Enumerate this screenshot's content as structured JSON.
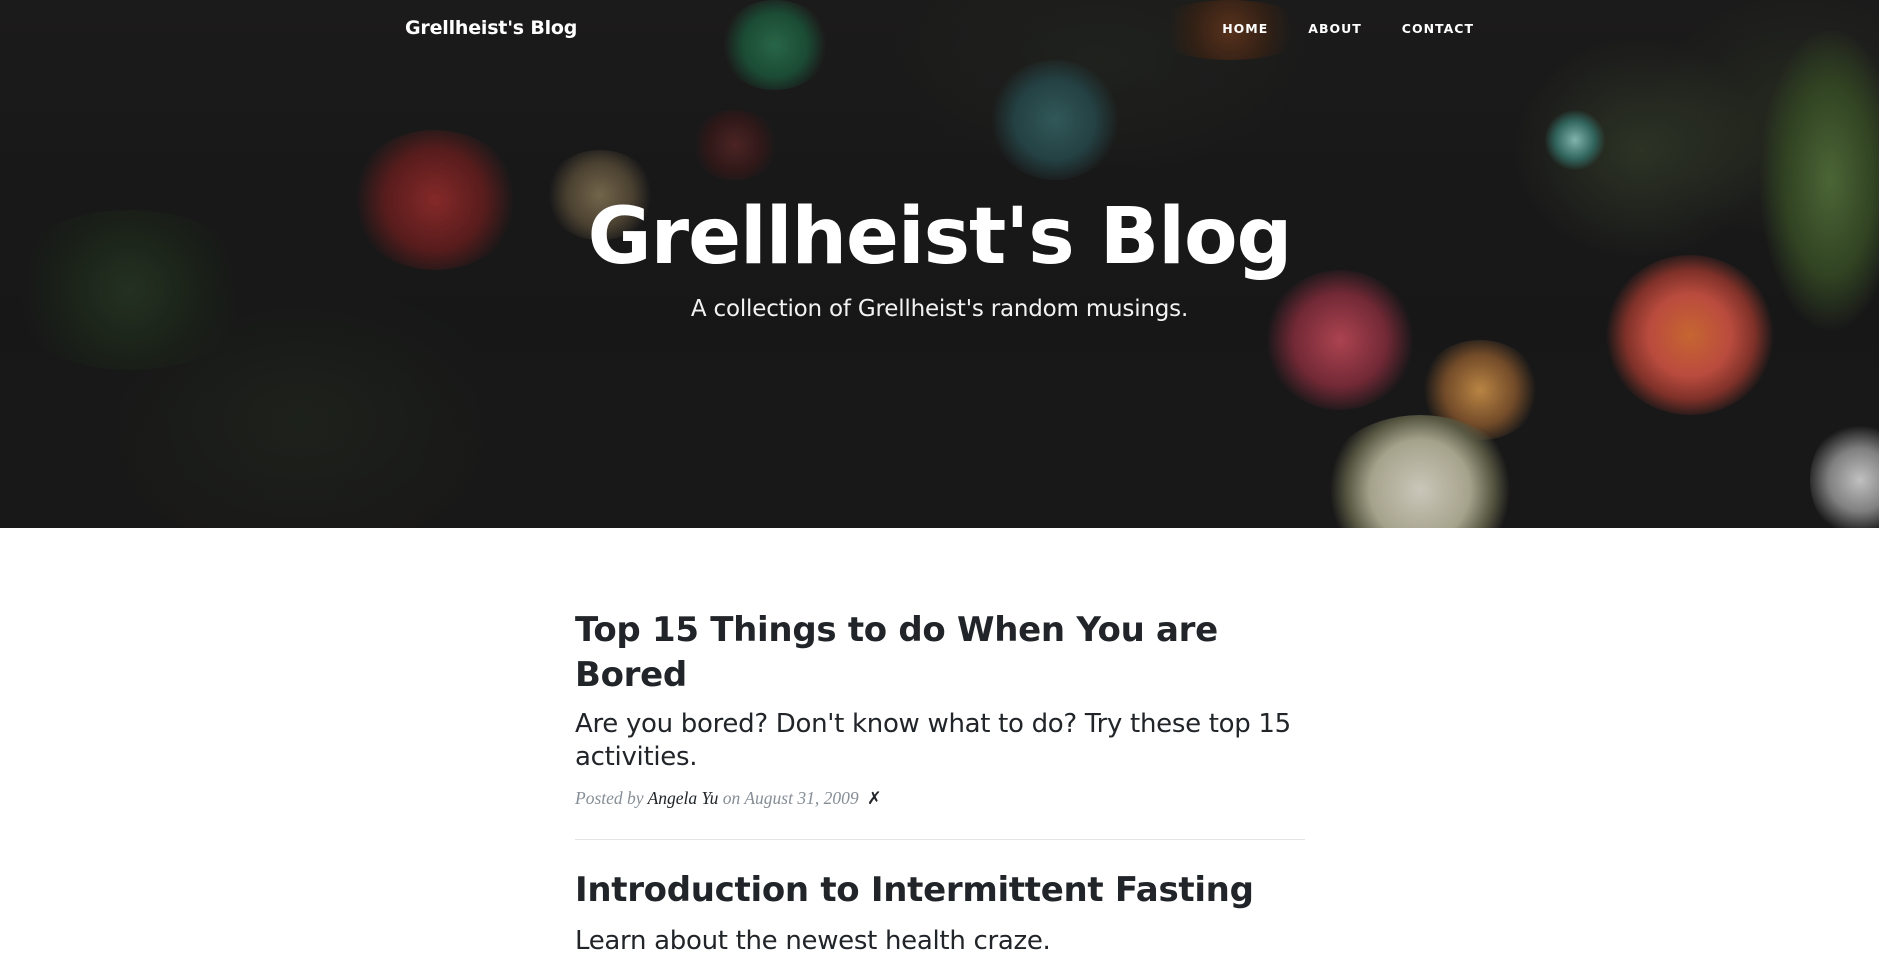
{
  "nav": {
    "brand": "Grellheist's Blog",
    "links": [
      "HOME",
      "ABOUT",
      "CONTACT"
    ]
  },
  "hero": {
    "title": "Grellheist's Blog",
    "subheading": "A collection of Grellheist's random musings."
  },
  "posts": [
    {
      "title": "Top 15 Things to do When You are Bored",
      "subtitle": "Are you bored? Don't know what to do? Try these top 15 activities.",
      "meta_prefix": "Posted by",
      "author": "Angela Yu",
      "meta_on": "on",
      "date": "August 31, 2009",
      "delete_symbol": "✗"
    },
    {
      "title": "Introduction to Intermittent Fasting",
      "subtitle": "Learn about the newest health craze."
    }
  ],
  "colors": {
    "text": "#212529",
    "muted": "#868e96",
    "hero_bg": "#1b1a1b"
  }
}
